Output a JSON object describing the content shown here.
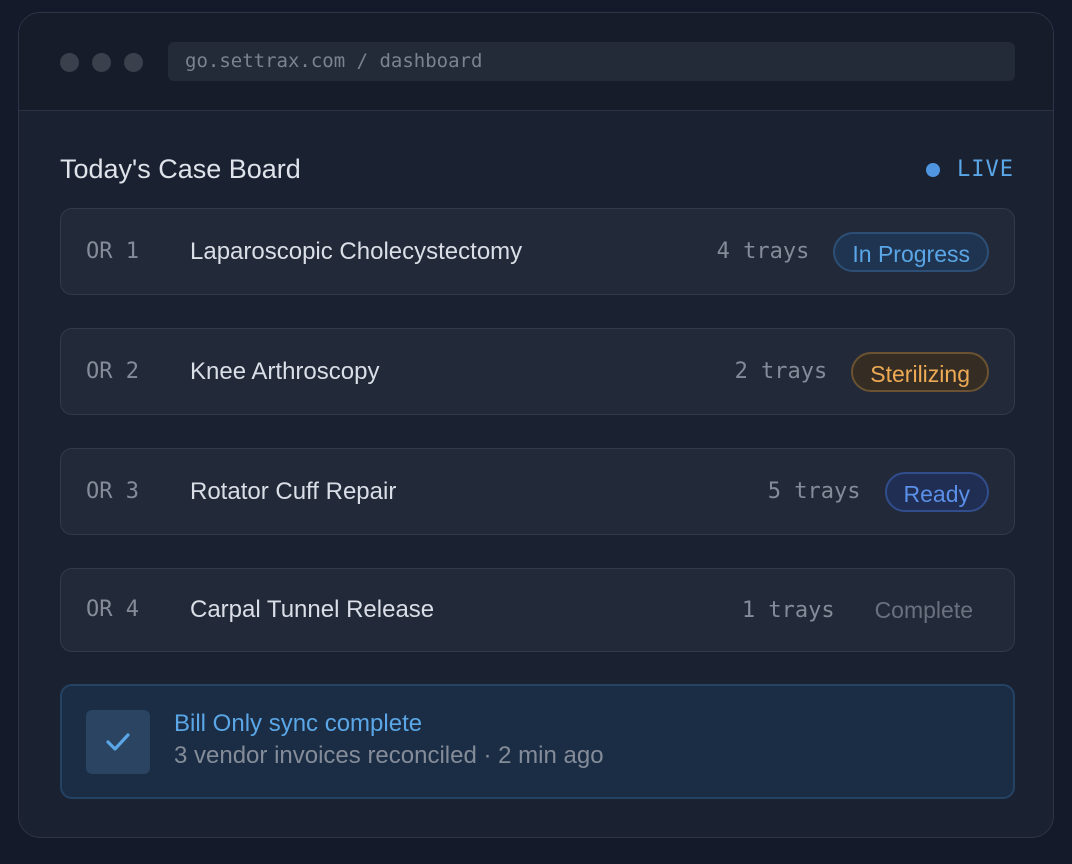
{
  "window": {
    "url": "go.settrax.com / dashboard"
  },
  "board": {
    "title": "Today's Case Board",
    "live_label": "LIVE"
  },
  "cases": [
    {
      "room": "OR 1",
      "procedure": "Laparoscopic Cholecystectomy",
      "trays": "4 trays",
      "status": "In Progress",
      "status_color": "#5aa6e6"
    },
    {
      "room": "OR 2",
      "procedure": "Knee Arthroscopy",
      "trays": "2 trays",
      "status": "Sterilizing",
      "status_color": "#eeaa54"
    },
    {
      "room": "OR 3",
      "procedure": "Rotator Cuff Repair",
      "trays": "5 trays",
      "status": "Ready",
      "status_color": "#5b8fe8"
    },
    {
      "room": "OR 4",
      "procedure": "Carpal Tunnel Release",
      "trays": "1 trays",
      "status": "Complete",
      "status_color": "#6a717e"
    }
  ],
  "notification": {
    "icon": "check-icon",
    "title": "Bill Only sync complete",
    "subtitle": "3 vendor invoices reconciled · 2 min ago"
  }
}
